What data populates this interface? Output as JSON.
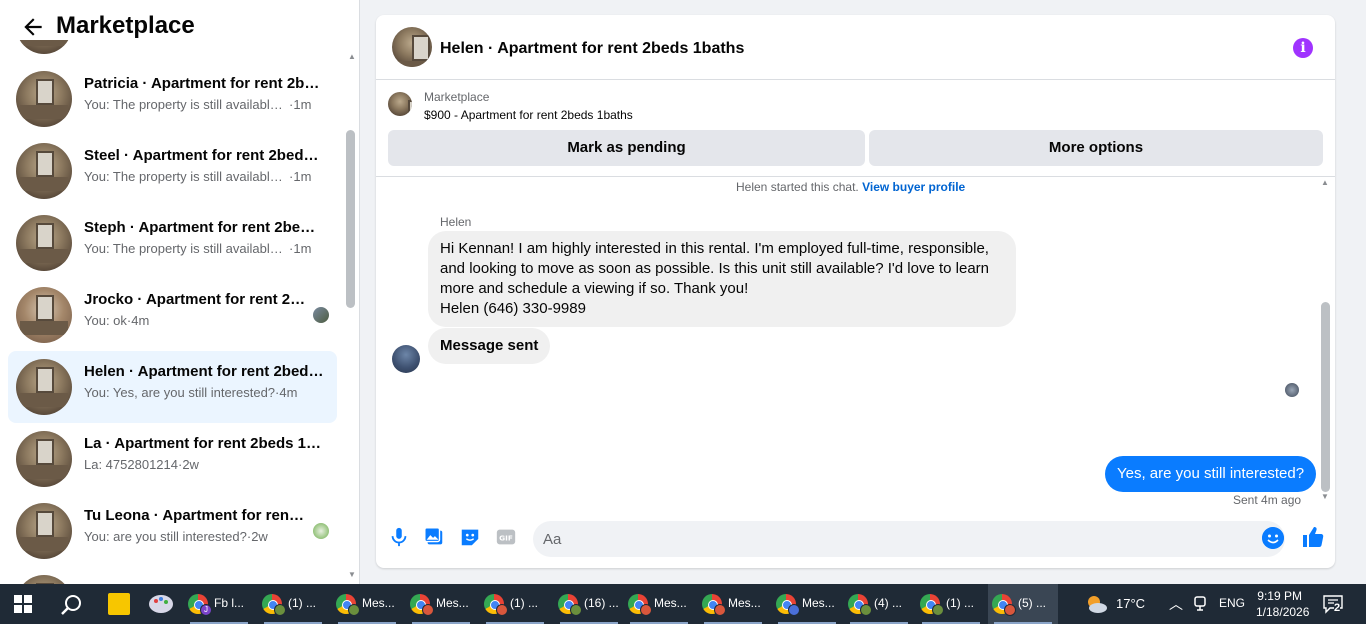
{
  "left_panel": {
    "title": "Marketplace",
    "conversations": [
      {
        "title": "Patricia · Apartment for rent 2beds 1baths",
        "subtitle": "You: The property is still available. I...",
        "time": "1m"
      },
      {
        "title": "Steel · Apartment for rent 2beds 1baths",
        "subtitle": "You: The property is still available. I...",
        "time": "1m"
      },
      {
        "title": "Steph · Apartment for rent 2beds 1baths",
        "subtitle": "You: The property is still available. I...",
        "time": "1m"
      },
      {
        "title": "Jrocko · Apartment for rent 2beds 1baths",
        "subtitle": "You: ok",
        "time": "4m"
      },
      {
        "title": "Helen · Apartment for rent 2beds 1baths",
        "subtitle": "You: Yes, are you still interested?",
        "time": "4m",
        "active": true
      },
      {
        "title": "La · Apartment for rent 2beds 1baths",
        "subtitle": "La: 4752801214",
        "time": "2w"
      },
      {
        "title": "Tu Leona · Apartment for rent 2beds 1baths",
        "subtitle": "You: are you still interested?",
        "time": "2w"
      }
    ]
  },
  "chat": {
    "header_title": "Helen · Apartment for rent 2beds 1baths",
    "listing_label": "Marketplace",
    "listing_price_title": "$900 - Apartment for rent 2beds 1baths",
    "mark_pending": "Mark as pending",
    "more_options": "More options",
    "started_text": "Helen started this chat.",
    "view_profile": "View buyer profile",
    "sender_name": "Helen",
    "incoming_lines": [
      "Hi Kennan! I am highly interested in this rental. I'm employed full-time, responsible,",
      "and looking to move as soon as possible. Is this unit still available? I'd love to learn",
      "more and schedule a viewing if so. Thank you!",
      "Helen (646) 330-9989"
    ],
    "message_sent": "Message sent",
    "outgoing": "Yes, are you still interested?",
    "sent_status": "Sent 4m ago",
    "input_placeholder": "Aa"
  },
  "taskbar": {
    "items": [
      {
        "label": "Fb l...",
        "badge": "p",
        "badge_text": "J"
      },
      {
        "label": "(1) ...",
        "badge": "g"
      },
      {
        "label": "Mes...",
        "badge": "g"
      },
      {
        "label": "Mes...",
        "badge": "r"
      },
      {
        "label": "(1) ...",
        "badge": "r"
      },
      {
        "label": "(16) ...",
        "badge": "g"
      },
      {
        "label": "Mes...",
        "badge": "r"
      },
      {
        "label": "Mes...",
        "badge": "r"
      },
      {
        "label": "Mes...",
        "badge": "b"
      },
      {
        "label": "(4) ...",
        "badge": "g"
      },
      {
        "label": "(1) ...",
        "badge": "g"
      },
      {
        "label": "(5) ...",
        "badge": "r",
        "active": true
      }
    ],
    "temperature": "17°C",
    "language": "ENG",
    "time": "9:19 PM",
    "date": "1/18/2026",
    "notifications": "2"
  }
}
